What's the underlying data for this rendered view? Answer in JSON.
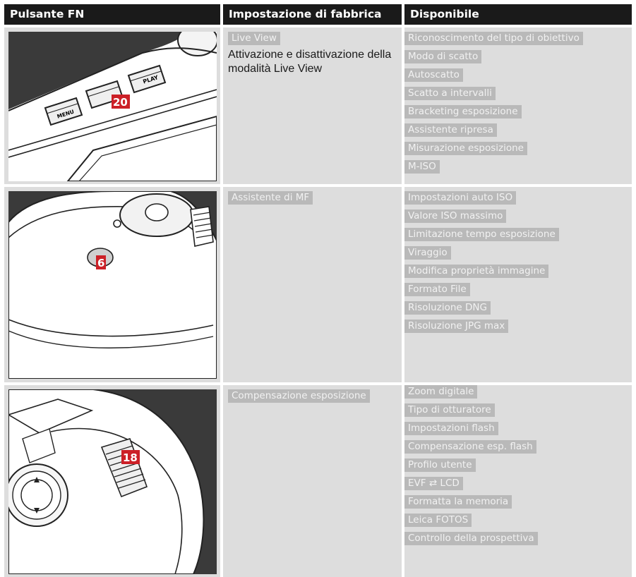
{
  "headers": {
    "fn_button": "Pulsante FN",
    "factory": "Impostazione di fabbrica",
    "available": "Disponibile"
  },
  "rows": [
    {
      "callout": "20",
      "factory_label": "Live View",
      "factory_desc": "Attivazione e disattivazione della modalità Live View",
      "illustration_buttons": [
        "PLAY",
        "MENU"
      ],
      "available": [
        "Riconoscimento del tipo di obiettivo",
        "Modo di scatto",
        "Autoscatto",
        "Scatto a intervalli",
        "Bracketing esposizione",
        "Assistente ripresa",
        "Misurazione esposizione",
        "M-ISO"
      ]
    },
    {
      "callout": "6",
      "factory_label": "Assistente di MF",
      "available": [
        "Impostazioni auto ISO",
        "Valore ISO massimo",
        "Limitazione tempo esposizione",
        "Viraggio",
        "Modifica proprietà immagine",
        "Formato File",
        "Risoluzione DNG",
        "Risoluzione JPG max"
      ]
    },
    {
      "callout": "18",
      "factory_label": "Compensazione esposizione",
      "available": [
        "Zoom digitale",
        "Tipo di otturatore",
        "Impostazioni flash",
        "Compensazione esp. flash",
        "Profilo utente",
        "EVF ⇄ LCD",
        "Formatta la memoria",
        "Leica FOTOS",
        "Controllo della prospettiva"
      ]
    }
  ],
  "colors": {
    "header_bg": "#1a1a1a",
    "cell_bg": "#dddddd",
    "tag_bg": "#b9b9b9",
    "callout_bg": "#cc2027"
  }
}
